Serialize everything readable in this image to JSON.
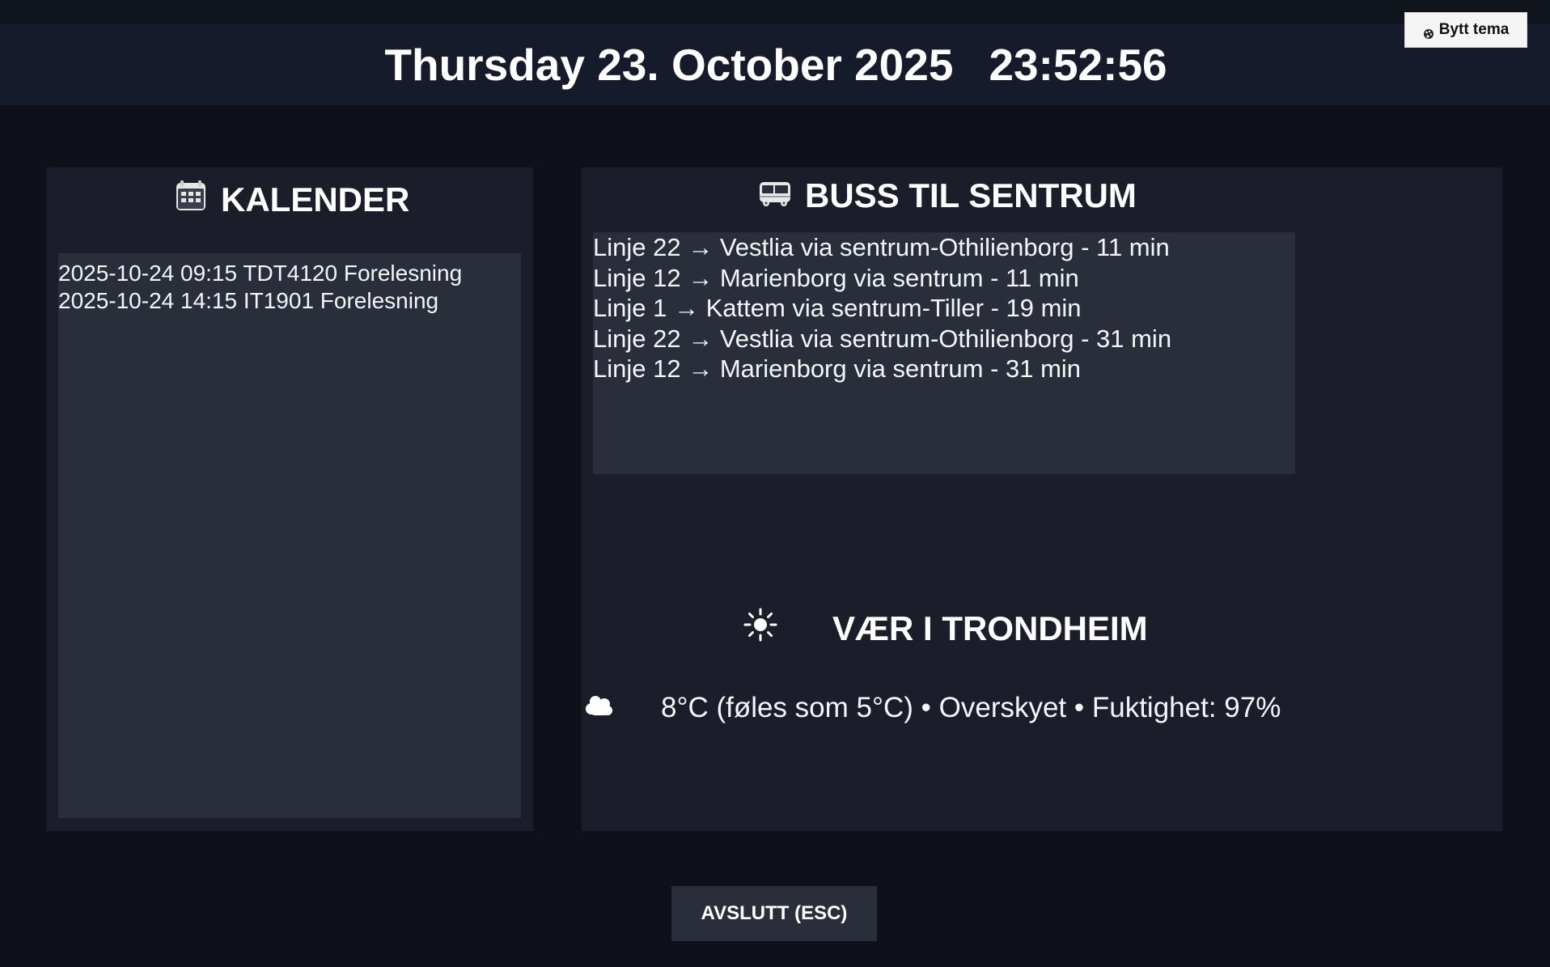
{
  "header": {
    "date": "Thursday 23. October 2025",
    "time": "23:52:56"
  },
  "theme_button": {
    "label": "Bytt tema",
    "icon": "palette-icon"
  },
  "calendar": {
    "title": "KALENDER",
    "icon": "calendar-icon",
    "items": [
      "2025-10-24 09:15 TDT4120 Forelesning",
      "2025-10-24 14:15 IT1901 Forelesning"
    ]
  },
  "bus": {
    "title": "BUSS TIL SENTRUM",
    "icon": "bus-icon",
    "departures": [
      "Linje 22 → Vestlia via sentrum-Othilienborg - 11 min",
      "Linje 12 → Marienborg via sentrum - 11 min",
      "Linje 1 → Kattem via sentrum-Tiller - 19 min",
      "Linje 22 → Vestlia via sentrum-Othilienborg - 31 min",
      "Linje 12 → Marienborg via sentrum - 31 min"
    ]
  },
  "weather": {
    "title": "VÆR I TRONDHEIM",
    "title_icon": "sun-icon",
    "condition_icon": "cloud-icon",
    "summary": "8°C (føles som 5°C) • Overskyet • Fuktighet: 97%"
  },
  "exit_button": {
    "label": "AVSLUTT (ESC)"
  },
  "colors": {
    "background": "#0e1119",
    "header": "#151b2b",
    "panel": "#1b1e2a",
    "list": "#2a2e3b",
    "text": "#f4f5f8"
  }
}
